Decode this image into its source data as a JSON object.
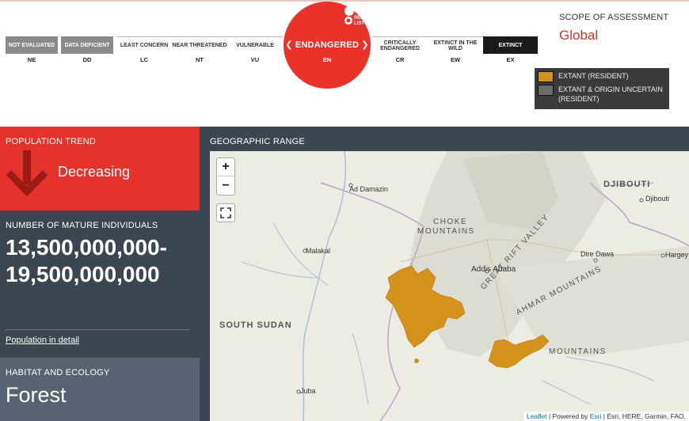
{
  "status_scale": {
    "categories": [
      {
        "label": "NOT EVALUATED",
        "abbr": "NE"
      },
      {
        "label": "DATA DEFICIENT",
        "abbr": "DD"
      },
      {
        "label": "LEAST CONCERN",
        "abbr": "LC"
      },
      {
        "label": "NEAR THREATENED",
        "abbr": "NT"
      },
      {
        "label": "VULNERABLE",
        "abbr": "VU"
      },
      {
        "label": "CRITICALLY ENDANGERED",
        "abbr": "CR"
      },
      {
        "label": "EXTINCT IN THE WILD",
        "abbr": "EW"
      },
      {
        "label": "EXTINCT",
        "abbr": "EX"
      }
    ],
    "current": {
      "label": "ENDANGERED",
      "abbr": "EN",
      "color": "#e8322a"
    },
    "logo_text": "RED LIST"
  },
  "scope": {
    "title": "SCOPE OF ASSESSMENT",
    "value": "Global",
    "color": "#c0392b"
  },
  "legend": {
    "items": [
      {
        "label": "EXTANT (RESIDENT)",
        "color": "#d4921c"
      },
      {
        "label": "EXTANT & ORIGIN UNCERTAIN (RESIDENT)",
        "color": "#6b6b6b"
      }
    ]
  },
  "population_trend": {
    "label": "POPULATION TREND",
    "value": "Decreasing",
    "icon": "down-arrow-icon",
    "color": "#e5322a"
  },
  "mature_individuals": {
    "label": "NUMBER OF MATURE INDIVIDUALS",
    "value": "13,500,000,000-19,500,000,000",
    "link": "Population in detail"
  },
  "habitat": {
    "label": "HABITAT AND ECOLOGY",
    "value": "Forest"
  },
  "geographic_range": {
    "label": "GEOGRAPHIC RANGE",
    "zoom_in": "+",
    "zoom_out": "−",
    "places": {
      "ad_damazin": "Ad Damazin",
      "djibouti_country": "DJIBOUTI",
      "djibouti_city": "Djibouti",
      "choke_1": "CHOKE",
      "choke_2": "MOUNTAINS",
      "malakal": "Malakal",
      "dire_dawa": "Dire Dawa",
      "hargeysa": "Hargey",
      "addis_ababa": "Addis Ababa",
      "great_rift": "GREAT RIFT VALLEY",
      "ahmar": "AHMAR MOUNTAINS",
      "south_sudan": "SOUTH SUDAN",
      "mountains": "MOUNTAINS",
      "juba": "Juba"
    },
    "attribution": {
      "leaflet": "Leaflet",
      "powered": " | Powered by ",
      "esri": "Esri",
      "rest": " | Esri, HERE, Garmin, FAO,"
    }
  }
}
